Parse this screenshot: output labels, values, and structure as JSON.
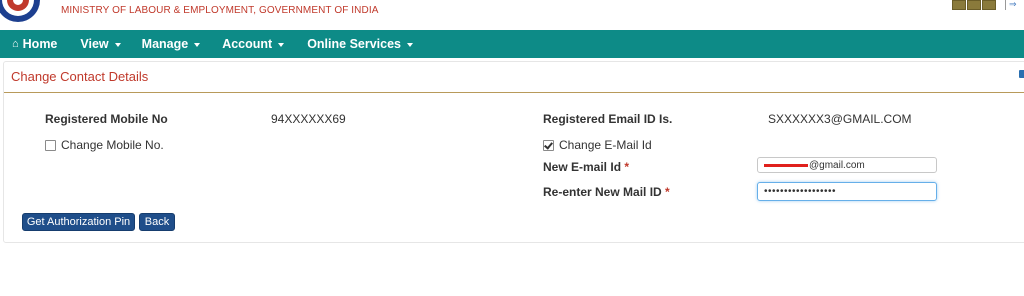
{
  "header": {
    "ministry": "MINISTRY OF LABOUR & EMPLOYMENT, GOVERNMENT OF INDIA"
  },
  "navbar": {
    "home": "Home",
    "view": "View",
    "manage": "Manage",
    "account": "Account",
    "online_services": "Online Services"
  },
  "panel": {
    "title": "Change Contact Details"
  },
  "form": {
    "mobile_label": "Registered Mobile No",
    "mobile_value": "94XXXXXX69",
    "change_mobile_label": "Change Mobile No.",
    "change_mobile_checked": false,
    "email_label": "Registered Email ID Is.",
    "email_value": "SXXXXXX3@GMAIL.COM",
    "change_email_label": "Change E-Mail Id",
    "change_email_checked": true,
    "new_email_label": "New E-mail Id",
    "new_email_value_suffix": "@gmail.com",
    "reenter_label": "Re-enter New Mail ID",
    "reenter_value": "••••••••••••••••••",
    "required_mark": "*"
  },
  "buttons": {
    "get_pin": "Get Authorization Pin",
    "back": "Back"
  },
  "colors": {
    "navbar": "#0d8b87",
    "title_red": "#c0392b",
    "button": "#1f4e8a"
  }
}
